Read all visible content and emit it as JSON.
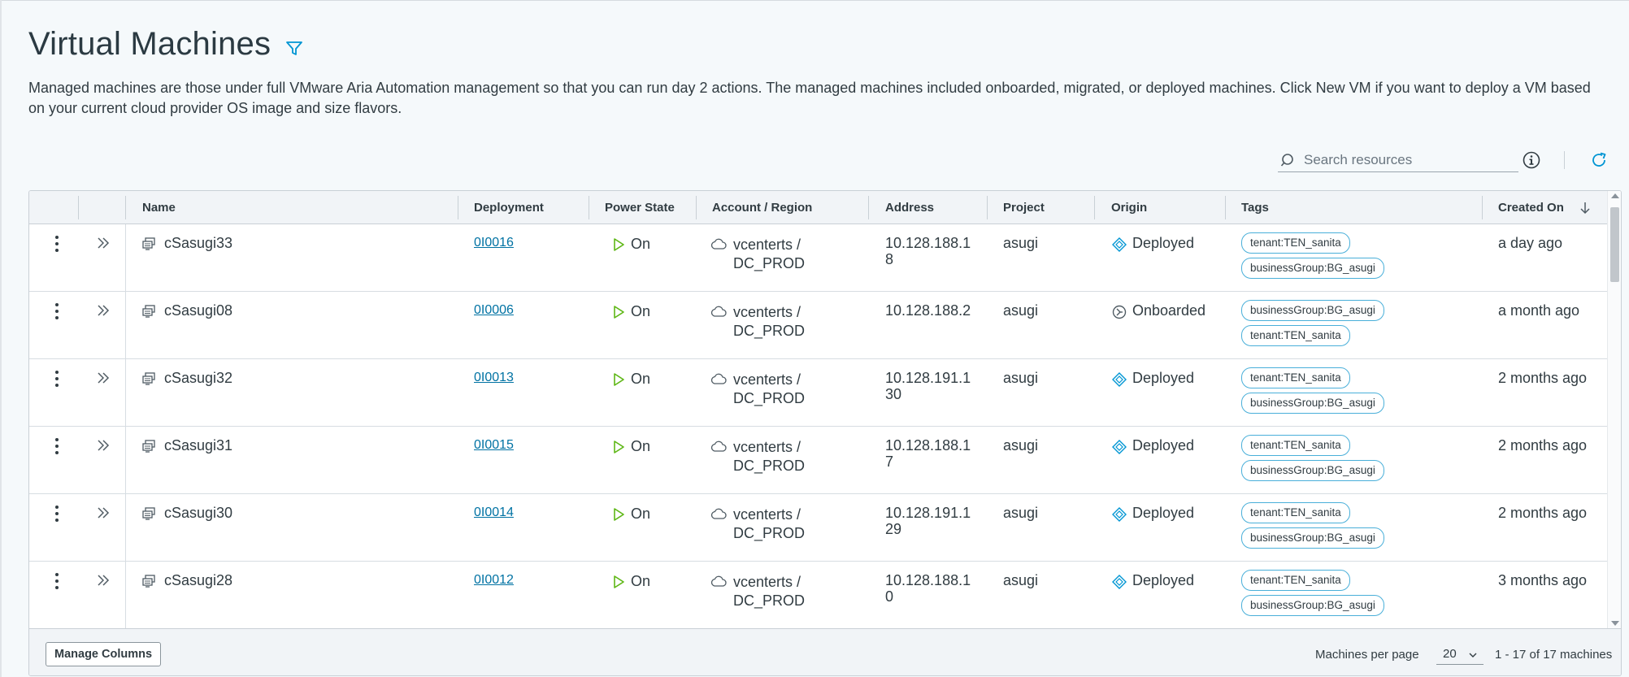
{
  "page": {
    "title": "Virtual Machines",
    "description": "Managed machines are those under full VMware Aria Automation management so that you can run day 2 actions. The managed machines included onboarded, migrated, or deployed machines. Click New VM if you want to deploy a VM based on your current cloud provider OS image and size flavors."
  },
  "toolbar": {
    "search_placeholder": "Search resources"
  },
  "table": {
    "columns": {
      "name": "Name",
      "deployment": "Deployment",
      "power_state": "Power State",
      "account_region": "Account / Region",
      "address": "Address",
      "project": "Project",
      "origin": "Origin",
      "tags": "Tags",
      "created_on": "Created On"
    },
    "rows": [
      {
        "name": "cSasugi33",
        "deployment": "0I0016",
        "power": "On",
        "account": "vcenterts /",
        "region": "DC_PROD",
        "address": "10.128.188.18",
        "project": "asugi",
        "origin": "Deployed",
        "tags": [
          "tenant:TEN_sanita",
          "businessGroup:BG_asugi"
        ],
        "created": "a day ago"
      },
      {
        "name": "cSasugi08",
        "deployment": "0I0006",
        "power": "On",
        "account": "vcenterts /",
        "region": "DC_PROD",
        "address": "10.128.188.2",
        "project": "asugi",
        "origin": "Onboarded",
        "tags": [
          "businessGroup:BG_asugi",
          "tenant:TEN_sanita"
        ],
        "created": "a month ago"
      },
      {
        "name": "cSasugi32",
        "deployment": "0I0013",
        "power": "On",
        "account": "vcenterts /",
        "region": "DC_PROD",
        "address": "10.128.191.130",
        "project": "asugi",
        "origin": "Deployed",
        "tags": [
          "tenant:TEN_sanita",
          "businessGroup:BG_asugi"
        ],
        "created": "2 months ago"
      },
      {
        "name": "cSasugi31",
        "deployment": "0I0015",
        "power": "On",
        "account": "vcenterts /",
        "region": "DC_PROD",
        "address": "10.128.188.17",
        "project": "asugi",
        "origin": "Deployed",
        "tags": [
          "tenant:TEN_sanita",
          "businessGroup:BG_asugi"
        ],
        "created": "2 months ago"
      },
      {
        "name": "cSasugi30",
        "deployment": "0I0014",
        "power": "On",
        "account": "vcenterts /",
        "region": "DC_PROD",
        "address": "10.128.191.129",
        "project": "asugi",
        "origin": "Deployed",
        "tags": [
          "tenant:TEN_sanita",
          "businessGroup:BG_asugi"
        ],
        "created": "2 months ago"
      },
      {
        "name": "cSasugi28",
        "deployment": "0I0012",
        "power": "On",
        "account": "vcenterts /",
        "region": "DC_PROD",
        "address": "10.128.188.10",
        "project": "asugi",
        "origin": "Deployed",
        "tags": [
          "tenant:TEN_sanita",
          "businessGroup:BG_asugi"
        ],
        "created": "3 months ago"
      }
    ]
  },
  "footer": {
    "manage_columns": "Manage Columns",
    "per_page_label": "Machines per page",
    "per_page_value": "20",
    "range": "1 - 17 of 17 machines"
  },
  "icons": {
    "filter": "filter-icon",
    "search": "search-icon",
    "info": "info-icon",
    "refresh": "refresh-icon",
    "sort": "arrow-down-icon",
    "kebab": "vertical-dots-icon",
    "expand": "double-chevron-right-icon",
    "vm": "vm-icon",
    "power_on": "play-icon",
    "cloud": "cloud-icon",
    "deployed": "blueprint-icon",
    "onboarded": "onboard-icon"
  },
  "colors": {
    "accent": "#0072a3",
    "tag_border": "#49afd9",
    "power_on": "#5eb715",
    "icon_blue": "#0095d3"
  }
}
